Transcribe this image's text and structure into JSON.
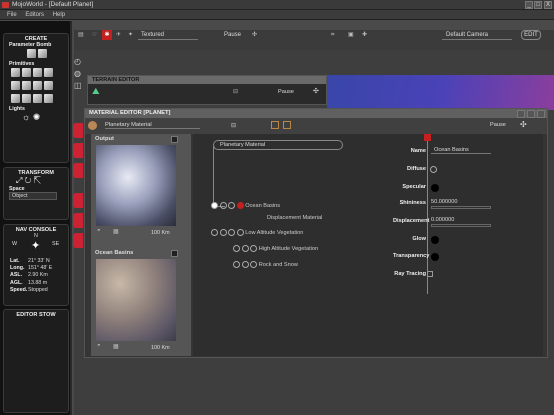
{
  "window": {
    "title": "MojoWorld - [Default Planet]",
    "controls": [
      "_",
      "□",
      "X"
    ]
  },
  "menu": [
    "File",
    "Editors",
    "Help"
  ],
  "left": {
    "create": "CREATE",
    "param_bomb": "Parameter Bomb",
    "primitives": "Primitives",
    "lights": "Lights",
    "transform": "TRANSFORM",
    "space": "Space",
    "space_value": "Object",
    "nav_console": "NAV CONSOLE",
    "compass": {
      "n": "N",
      "w": "W",
      "e": "SE"
    },
    "nav": [
      {
        "label": "Lat.",
        "value": "21° 33' N"
      },
      {
        "label": "Long.",
        "value": "151° 48' E"
      },
      {
        "label": "ASL.",
        "value": "2.90 Km"
      },
      {
        "label": "AGL.",
        "value": "13.88 m"
      },
      {
        "label": "Speed.",
        "value": "Stopped"
      }
    ],
    "editor_stow": "EDITOR STOW"
  },
  "toolbar": {
    "render_mode": "Textured",
    "pause": "Pause",
    "camera": "Default Camera",
    "edit": "EDIT"
  },
  "terrain_editor": {
    "title": "TERRAIN EDITOR",
    "pause": "Pause"
  },
  "material_editor": {
    "title": "MATERIAL EDITOR [PLANET]",
    "material_select": "Planetary Material",
    "pause": "Pause",
    "output_label": "Output",
    "output_scale": "100 Km",
    "basins_label": "Ocean Basins",
    "basins_scale": "100 Km",
    "graph": {
      "root": "Planetary Material",
      "nodes": [
        "Ocean Basins",
        "Displacement Material",
        "Low Altitude Vegetation",
        "High Altitude Vegetation",
        "Rock and Snow"
      ]
    },
    "props": [
      {
        "name": "Name",
        "value": "Ocean Basins"
      },
      {
        "name": "Diffuse",
        "value": ""
      },
      {
        "name": "Specular",
        "value": ""
      },
      {
        "name": "Shininess",
        "value": "50.000000"
      },
      {
        "name": "Displacement",
        "value": "0.000000"
      },
      {
        "name": "Glow",
        "value": ""
      },
      {
        "name": "Transparency",
        "value": ""
      },
      {
        "name": "Ray Tracing",
        "value": ""
      }
    ]
  },
  "colors": {
    "accent": "#c42020",
    "sky": "#4446b0",
    "panel": "#353535"
  }
}
